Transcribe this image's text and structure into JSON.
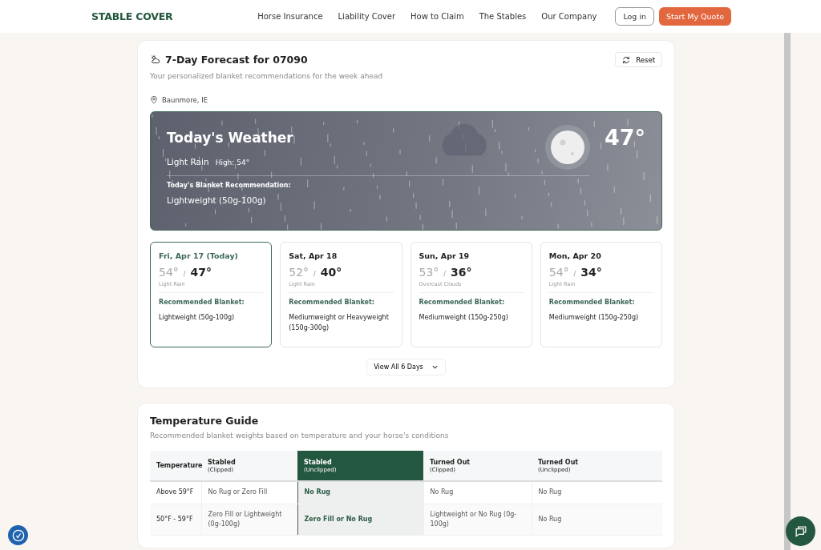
{
  "header": {
    "logo": "STABLE COVER",
    "nav": [
      "Horse Insurance",
      "Liability Cover",
      "How to Claim",
      "The Stables",
      "Our Company"
    ],
    "login": "Log in",
    "cta": "Start My Quote"
  },
  "forecast": {
    "title": "7-Day Forecast for 07090",
    "subtitle": "Your personalized blanket recommendations for the week ahead",
    "reset": "Reset",
    "location": "Baunmore, IE",
    "today": {
      "title": "Today's Weather",
      "temp": "47°",
      "condition": "Light Rain",
      "high": "High: 54°",
      "rec_label": "Today's Blanket Recommendation:",
      "rec": "Lightweight (50g-100g)"
    },
    "days": [
      {
        "date": "Fri, Apr 17 (Today)",
        "high": "54°",
        "sep": "/",
        "low": "47°",
        "condition": "Light Rain",
        "rec_label": "Recommended Blanket:",
        "rec": "Lightweight (50g-100g)",
        "selected": true
      },
      {
        "date": "Sat, Apr 18",
        "high": "52°",
        "sep": "/",
        "low": "40°",
        "condition": "Light Rain",
        "rec_label": "Recommended Blanket:",
        "rec": "Mediumweight or Heavyweight (150g-300g)",
        "selected": false
      },
      {
        "date": "Sun, Apr 19",
        "high": "53°",
        "sep": "/",
        "low": "36°",
        "condition": "Overcast Clouds",
        "rec_label": "Recommended Blanket:",
        "rec": "Mediumweight (150g-250g)",
        "selected": false
      },
      {
        "date": "Mon, Apr 20",
        "high": "54°",
        "sep": "/",
        "low": "34°",
        "condition": "Light Rain",
        "rec_label": "Recommended Blanket:",
        "rec": "Mediumweight (150g-250g)",
        "selected": false
      }
    ],
    "view_all": "View All 6 Days"
  },
  "guide": {
    "title": "Temperature Guide",
    "subtitle": "Recommended blanket weights based on temperature and your horse's conditions",
    "columns": [
      {
        "label": "Temperature",
        "selected": false
      },
      {
        "label": "Stabled",
        "sub": "(Clipped)",
        "selected": false
      },
      {
        "label": "Stabled",
        "sub": "(Unclipped)",
        "selected": true
      },
      {
        "label": "Turned Out",
        "sub": "(Clipped)",
        "selected": false
      },
      {
        "label": "Turned Out",
        "sub": "(Unclipped)",
        "selected": false
      }
    ],
    "rows": [
      [
        "Above 59°F",
        "No Rug or Zero Fill",
        "No Rug",
        "No Rug",
        "No Rug"
      ],
      [
        "50°F - 59°F",
        "Zero Fill or Lightweight (0g-100g)",
        "Zero Fill or No Rug",
        "Lightweight or No Rug (0g-100g)",
        "No Rug"
      ]
    ]
  }
}
